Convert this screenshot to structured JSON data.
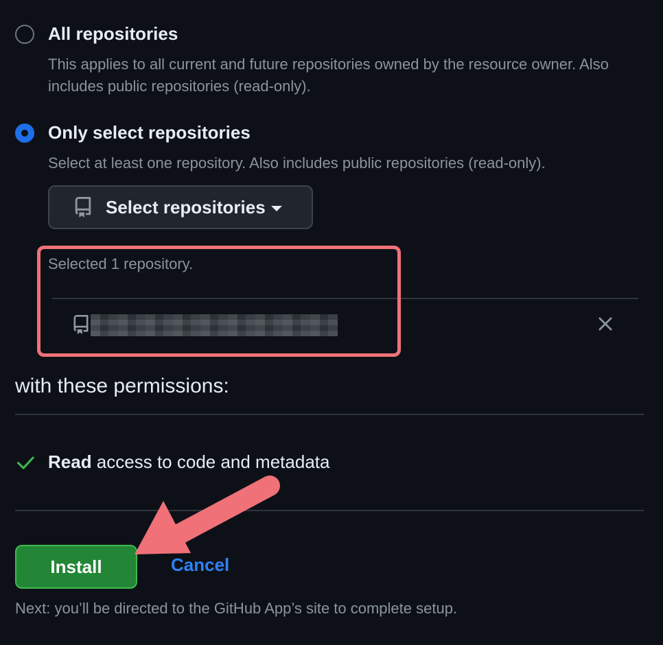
{
  "options": [
    {
      "title": "All repositories",
      "description": "This applies to all current and future repositories owned by the resource owner. Also includes public repositories (read-only).",
      "selected": false
    },
    {
      "title": "Only select repositories",
      "description": "Select at least one repository. Also includes public repositories (read-only).",
      "selected": true
    }
  ],
  "select_button": {
    "label": "Select repositories",
    "icon": "repo-icon"
  },
  "selection": {
    "summary": "Selected 1 repository.",
    "items": [
      {
        "icon": "repo-icon",
        "name_redacted": true
      }
    ]
  },
  "permissions": {
    "heading": "with these permissions:",
    "items": [
      {
        "bold": "Read",
        "rest": " access to code and metadata",
        "icon": "check-icon"
      }
    ]
  },
  "actions": {
    "install_label": "Install",
    "cancel_label": "Cancel",
    "next_note": "Next: you’ll be directed to the GitHub App’s site to complete setup."
  },
  "colors": {
    "background": "#0d1117",
    "accent_blue": "#1f6feb",
    "install_green": "#238636",
    "highlight": "#f07178",
    "check_green": "#3fb950"
  }
}
